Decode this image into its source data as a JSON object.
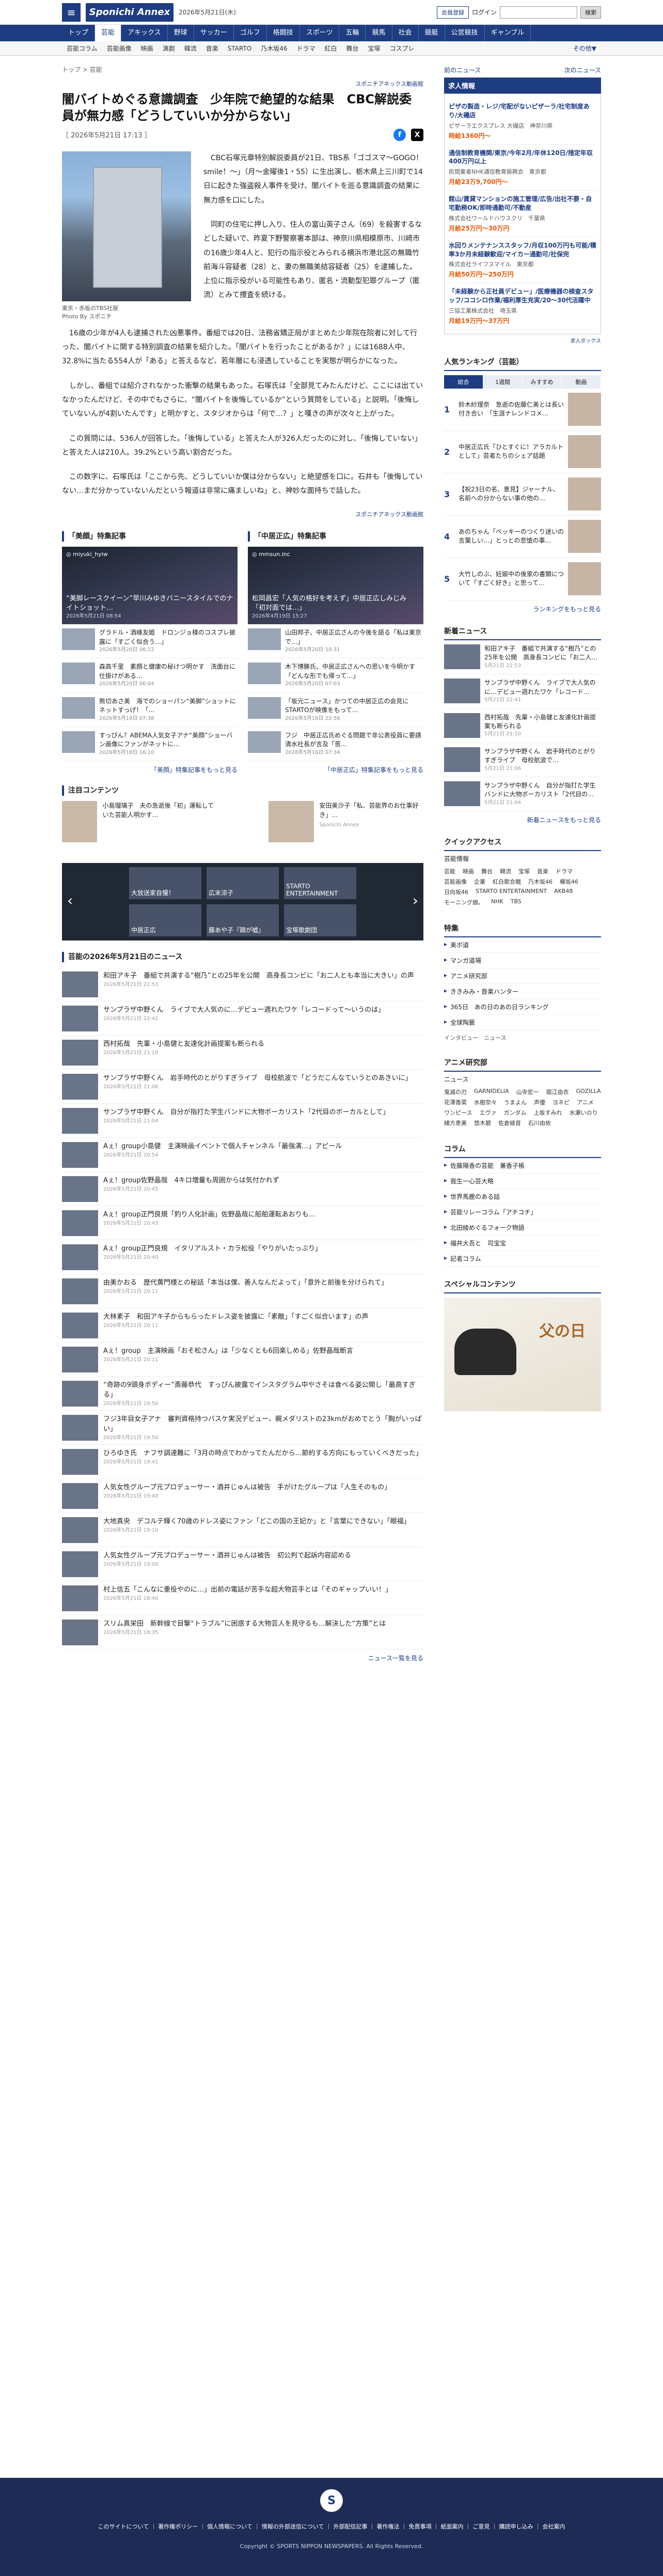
{
  "header": {
    "logo": "Sponichi Annex",
    "date": "2026年5月21日(木)",
    "member_btn": "会員登録",
    "login": "ログイン",
    "search_btn": "検索"
  },
  "gnav": [
    "トップ",
    "芸能",
    "アキックス",
    "野球",
    "サッカー",
    "ゴルフ",
    "格闘技",
    "スポーツ",
    "五輪",
    "競馬",
    "社会",
    "競艇",
    "公営競技",
    "ギャンブル"
  ],
  "snav": [
    "芸能コラム",
    "芸能画像",
    "映画",
    "演劇",
    "韓流",
    "音楽",
    "STARTO",
    "乃木坂46",
    "ドラマ",
    "紅白",
    "舞台",
    "宝塚",
    "コスプレ"
  ],
  "snav_more": "その他▼",
  "crumb": "トップ > 芸能",
  "article": {
    "section_tag": "スポニチアネックス動画館",
    "title": "闇バイトめぐる意識調査　少年院で絶望的な結果　CBC解説委員が無力感「どうしていいか分からない」",
    "date": "［ 2026年5月21日 17:13 ］",
    "caption": "東京・赤坂のTBS社屋",
    "credit": "Photo By スポニチ",
    "p1": "CBC石塚元章特別解説委員が21日、TBS系「ゴゴスマ～GOGO！smile！～」（月～金曜後1・55）に生出演し、栃木県上三川町で14日に起きた強盗殺人事件を受け、闇バイトを巡る意識調査の結果に無力感を口にした。",
    "p2": "同町の住宅に押し入り、住人の富山英子さん（69）を殺害するなどした疑いで、昨夏下野警察署本部は、神奈川県相模原市、川崎市の16歳少年4人と、犯行の指示役とみられる横浜市港北区の無職竹前海斗容疑者（28）と、妻の無職美結容疑者（25）を逮捕した。上位に指示役がいる可能性もあり、匿名・流動型犯罪グループ（匿流）とみて捜査を続ける。",
    "p3": "16歳の少年が4人も逮捕された凶悪事件。番組では20日、法務省矯正局がまとめた少年院在院者に対して行った、闇バイトに関する特別調査の結果を紹介した。「闇バイトを行ったことがあるか？」には1688人中、32.8%に当たる554人が「ある」と答えるなど、若年層にも浸透していることを実態が明らかになった。",
    "p4": "しかし、番組では紹介されなかった衝撃の結果もあった。石塚氏は「全部見てみたんだけど、ここには出ていなかったんだけど、その中でもさらに、“闇バイトを後悔しているか”という質問をしている」と説明。「後悔していないんが4割いたんです」と明かすと、スタジオからは「何で…？」と嘆きの声が次々と上がった。",
    "p5": "この質問には、536人が回答した。「後悔している」と答えた人が326人だったのに対し、「後悔していない」と答えた人は210人。39.2%という高い割合だった。",
    "p6": "この数字に、石塚氏は「ここから先、どうしていいか僕は分からない」と絶望感を口に。石井も「後悔していない…まだ分かっていないんだという報道は非常に痛ましいね」と、神妙な面持ちで話した。",
    "source": "スポニチアネックス動画館"
  },
  "features": {
    "left": {
      "heading": "「美顔」特集記事",
      "account": "miyuki_hyiw",
      "title": "“美脚レースクイーン”早川みゆきバニースタイルでのナイトショット…",
      "date": "2026年5月21日 08:54",
      "more": "「美顔」特集記事をもっと見る",
      "items": [
        {
          "t": "グラドル・酒峰友姫　ドロンジョ様のコスプレ披露に「すごく似合う…」",
          "d": "2026年5月20日 06:22"
        },
        {
          "t": "森高千里　素顔と健康の秘けつ明かす　洗面台に仕掛けがある…",
          "d": "2026年5月20日 06:04"
        },
        {
          "t": "熊切あさ美　海でのショーパン“美脚”ショットにネットすっげ！「…",
          "d": "2026年5月19日 07:38"
        },
        {
          "t": "すっぴん？ABEMA人気女子アナ“美顔”ショーバン画像にファンがネットに…",
          "d": "2026年5月18日 16:10"
        }
      ]
    },
    "right": {
      "heading": "「中居正広」特集記事",
      "account": "mmsun.inc",
      "title": "松岡昌宏「人気の格好を考えず」中居正広しみじみ「初対面では…」",
      "date": "2026年4月19日 15:27",
      "more": "「中居正広」特集記事をもっと見る",
      "items": [
        {
          "t": "山田邦子、中居正広さんの今後を語る「私は東京で…」",
          "d": "2026年5月20日 10:31"
        },
        {
          "t": "木下博勝氏、中居正広さんへの思いを今明かす「どんな形でも帰って…」",
          "d": "2026年5月20日 07:03"
        },
        {
          "t": "「坂元ニュース」かつての中居正広の会見にSTARTOが映像をもって…",
          "d": "2026年5月16日 22:56"
        },
        {
          "t": "フジ　中居正広氏めぐる問題で非公表役員に要請　清水社長が言及「苦…",
          "d": "2026年5月16日 07:34"
        }
      ]
    }
  },
  "attention": {
    "heading": "注目コンテンツ",
    "items": [
      {
        "t": "小島瑠璃子　夫の急逝後「初」運転していた芸能人明かす…"
      },
      {
        "t": "安田美沙子「私、芸能界のお仕事好き」…",
        "sub": "Sponichi Annex"
      }
    ]
  },
  "carousel": [
    "大放送家自慢！",
    "広末涼子",
    "STARTO ENTERTAINMENT",
    "中居正広",
    "藤あや子『鶏が嘘』",
    "宝塚歌劇団"
  ],
  "newslist": {
    "heading": "芸能の2026年5月21日のニュース",
    "more": "ニュース一覧を見る",
    "items": [
      {
        "t": "和田アキ子　番組で共演する“樹乃”との25年を公開　高身長コンビに「お二人とも本当に大きい」の声",
        "d": "2026年5月21日 22:53"
      },
      {
        "t": "サンプラザ中野くん　ライブで大人気のに…デビュー週れたワケ「レコードって〜いうのは」",
        "d": "2026年5月21日 22:41"
      },
      {
        "t": "西村拓哉　先輩・小島健と友達化計画提案も断られる",
        "d": "2026年5月21日 21:10"
      },
      {
        "t": "サンプラザ中野くん　岩手時代のとがりすぎライブ　母校航波で「どうだこんなていうとのあきいに」",
        "d": "2026年5月21日 21:06"
      },
      {
        "t": "サンプラザ中野くん　自分が指打た学生バンドに大物ボーカリスト「2代目のボーカルとして」",
        "d": "2026年5月21日 21:04"
      },
      {
        "t": "Aぇ！group小島健　主演映画イベントで個人チャンネル「最強演…」アピール",
        "d": "2026年5月21日 20:54"
      },
      {
        "t": "Aぇ！group佐野晶哉　4キロ増量も周囲からは気付かれず",
        "d": "2026年5月21日 20:45"
      },
      {
        "t": "Aぇ！group正門良規「釣り人化計画」佐野晶哉に船舶運転あおりも…",
        "d": "2026年5月21日 20:43"
      },
      {
        "t": "Aぇ！group正門良規　イタリアルスト・カラ松役「やりがいたっぷり」",
        "d": "2026年5月21日 20:40"
      },
      {
        "t": "由美かおる　歴代黄門様との秘話「本当は僕、善人なんだよって」「意外と前後を分けられて」",
        "d": "2026年5月21日 20:11"
      },
      {
        "t": "大林素子　和田アキ子からもらったドレス姿を披露に「素敵」「すごく似合います」の声",
        "d": "2026年5月21日 20:11"
      },
      {
        "t": "Aぇ！group　主演映画「おそ松さん」は「少なくとも6回楽しめる」佐野晶哉断言",
        "d": "2026年5月21日 20:11"
      },
      {
        "t": "“奇跡の9頭身ボディー”斎藤恭代　すっぴん披露でインスタグラム中やさそは食べる姿公開し「最高すぎる」",
        "d": "2026年5月21日 19:50"
      },
      {
        "t": "フジ3年目女子アナ　審判資格持つバスケ実況デビュー、親メダリストの23kmがおめでとう「胸がいっぱい」",
        "d": "2026年5月21日 19:50"
      },
      {
        "t": "ひろゆき氏　ナフサ調達難に「3月の時点でわかってたんだから…節約する方向にもっていくべきだった」",
        "d": "2026年5月21日 19:41"
      },
      {
        "t": "人気女性グループ元プロデューサー・酒井じゅんは被告　手がけたグループは「人生そのもの」",
        "d": "2026年5月21日 19:40"
      },
      {
        "t": "大地真央　デコルテ輝く70歳のドレス姿にファン「どこの国の王妃か」と「言葉にできない」「眼福」",
        "d": "2026年5月21日 19:10"
      },
      {
        "t": "人気女性グループ元プロデューサー・酒井じゅんは被告　初公判で起訴内容認める",
        "d": "2026年5月21日 19:00"
      },
      {
        "t": "村上信五「こんなに重役やのに…」出前の電話が苦手な超大物芸手とは「そのギャップいい！」",
        "d": "2026年5月21日 18:40"
      },
      {
        "t": "スリム真栄田　新幹線で目撃“トラブル”に困惑する大物芸人を見守るも…解決した“方策”とは",
        "d": "2026年5月21日 18:35"
      }
    ]
  },
  "side": {
    "prev": "前のニュース",
    "next": "次のニュース",
    "jobs_heading": "求人情報",
    "jobs": [
      {
        "t": "ピザの製造・レジ/宅配がないピザーラ/社宅制度あり/大磯店",
        "c": "ピザーラエクスプレス 大磯店",
        "loc": "神奈川県",
        "p": "時給1360円〜"
      },
      {
        "t": "通信制教育機関/東京/今年2月/年休120日/措定年収400万円以上",
        "c": "民間業者NHK通信教育振興会",
        "loc": "東京都",
        "p": "月給23万9,700円〜"
      },
      {
        "t": "館山/賃貸マンションの施工管理/広告/出社不要・自宅勤務OK/即時通勤可/不動産",
        "c": "株式会社ワールドハウスクリ",
        "loc": "千葉県",
        "p": "月給25万円〜30万円"
      },
      {
        "t": "水回りメンテナンススタッフ/月収100万円も可能/積率3か月未経験歓迎/マイカー通勤可/社保完",
        "c": "株式会社ライフスマイル",
        "loc": "東京都",
        "p": "月給50万円〜250万円"
      },
      {
        "t": "「未経験から正社員デビュー」/医療機器の検査スタッフ/ココシロ作業/福利厚生充実/20〜30代活躍中",
        "c": "三協工業株式会社",
        "loc": "埼玉県",
        "p": "月給19万円〜37万円"
      }
    ],
    "jobs_credit": "求人ボックス",
    "ranking_heading": "人気ランキング（芸能）",
    "ranking_tabs": [
      "総合",
      "1週間",
      "みすすめ",
      "動画"
    ],
    "ranking": [
      {
        "n": "1",
        "t": "鈴木紗理奈　急逝の佐藤仁美とは長い付き合い　「生涯ナレンドコメ…"
      },
      {
        "t": "中居正広氏「ひとすぐに！アラカルトとして」芸者たちのシェア話題",
        "n": "2"
      },
      {
        "n": "3",
        "t": "【祝23日の名、意見】ジャーナル、名前への分からない事の他の…"
      },
      {
        "n": "4",
        "t": "あのちゃん「ベッキーのつくり迷いの言葉しい…」とっとの悲愴の事…"
      },
      {
        "n": "5",
        "t": "大竹しのぶ、妊娠中の後家の書類について「すごく好き」と思って…"
      }
    ],
    "ranking_more": "ランキングをもっと見る",
    "new_heading": "新着ニュース",
    "new_items": [
      {
        "t": "和田アキ子　番組で共演する“樹乃”との25年を公開　高身長コンビに「お二人…",
        "d": "5月21日 22:53"
      },
      {
        "t": "サンプラザ中野くん　ライブで大人気のに…デビュー週れたワケ「レコード…",
        "d": "5月21日 22:41"
      },
      {
        "t": "西村拓哉　先輩・小島健と友達化計画提案も断られる",
        "d": "5月21日 21:10"
      },
      {
        "t": "サンプラザ中野くん　岩手時代のとがりすぎライブ　母校航波で…",
        "d": "5月21日 21:06"
      },
      {
        "t": "サンプラザ中野くん　自分が指打た学生バンドに大物ボーカリスト「2代目の…",
        "d": "5月21日 21:04"
      }
    ],
    "new_more": "新着ニュースをもっと見る",
    "quick_heading": "クイックアクセス",
    "quick_sub": "芸能情報",
    "quick_links": [
      "芸能",
      "映画",
      "舞台",
      "韓流",
      "宝塚",
      "音楽",
      "ドラマ",
      "芸能画像",
      "企業",
      "紅白歌合戦",
      "乃木坂46",
      "欅坂46",
      "日向坂46",
      "STARTO ENTERTAINMENT",
      "AKB48",
      "モーニング娘。",
      "NHK",
      "TBS"
    ],
    "special_heading": "特集",
    "special_links": [
      "美ボ道",
      "マンガ道場",
      "アニメ研究部",
      "ききみみ・音楽ハンター",
      "365日　あの日のあの日ランキング",
      "全球陶藝"
    ],
    "special_sub": "インタビュー　ニュース",
    "anime_heading": "アニメ研究部",
    "anime_sub": "ニュース",
    "anime_tags": [
      "鬼滅の刃",
      "GARNIDELIA",
      "山寺宏一",
      "堀江由衣",
      "GOZILLA",
      "花澤香菜",
      "水樹奈々",
      "うまよん",
      "声優",
      "ヨネピ",
      "アニメ",
      "ワンピース",
      "エヴァ",
      "ガンダム",
      "上坂すみれ",
      "水瀬いのり",
      "緒方恵美",
      "悠木碧",
      "佐倉綾音",
      "石川由依"
    ],
    "column_heading": "コラム",
    "column_links": [
      "佐藤陽香の芸能　兼香子帳",
      "我生一心芸大略",
      "世界馬鹿のある話",
      "芸能リレーコラム「アチコチ」",
      "北田綾めぐるフォーク物語",
      "福井大吾と　司宝宝",
      "記者コラム"
    ],
    "sponsor_heading": "スペシャルコンテンツ",
    "sponsor_text": "父の日"
  },
  "footer": {
    "links": "このサイトについて ｜ 著作権ポリシー ｜ 個人情報について ｜ 情報の外部送信について ｜ 外部配信記事 ｜ 著作権法 ｜ 免責事項 ｜ 紙面案内 ｜ ご意見 ｜ 購読申し込み ｜ 会社案内",
    "copyright": "Copyright © SPORTS NIPPON NEWSPAPERS. All Rights Reserved."
  }
}
